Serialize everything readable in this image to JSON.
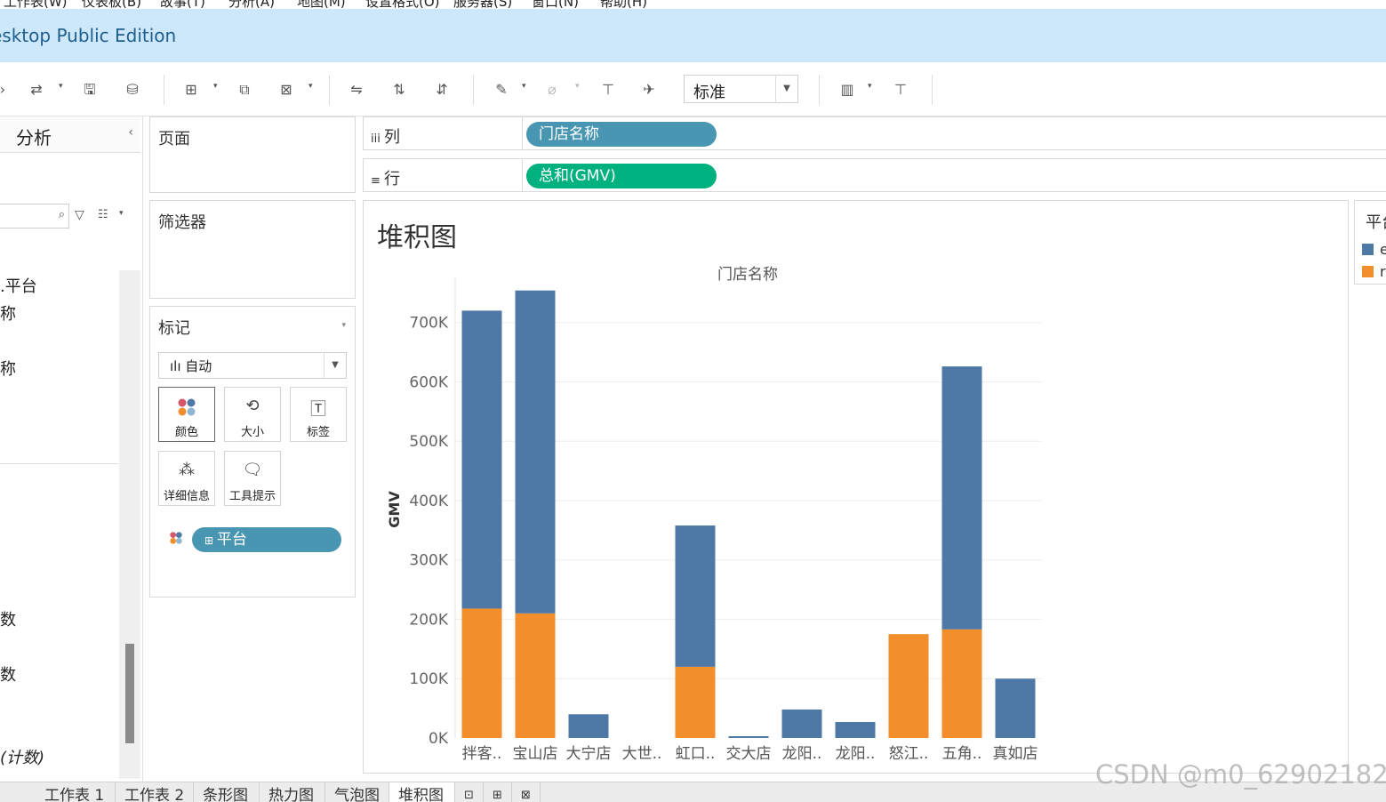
{
  "window": {
    "title": "esktop Public Edition",
    "menu": [
      "工作表(W)",
      "仪表板(B)",
      "故事(T)",
      "分析(A)",
      "地图(M)",
      "设置格式(O)",
      "服务器(S)",
      "窗口(N)",
      "帮助(H)"
    ]
  },
  "toolbar": {
    "fit_select": "标准"
  },
  "data_pane": {
    "tab_label": "分析",
    "collapse_icon": "chevron-left-icon",
    "fields": [
      ".平台",
      "称",
      "称",
      "数",
      "数",
      "(计数)"
    ]
  },
  "pages_shelf": {
    "title": "页面"
  },
  "filters_shelf": {
    "title": "筛选器"
  },
  "marks": {
    "title": "标记",
    "type": "自动",
    "buttons": {
      "color": "颜色",
      "size": "大小",
      "label": "标签",
      "detail": "详细信息",
      "tooltip": "工具提示"
    },
    "color_field": "平台",
    "colors": {
      "pill": "#4996b2"
    }
  },
  "columns_shelf": {
    "label": "列",
    "pill": "门店名称",
    "pill_color": "#4996b2"
  },
  "rows_shelf": {
    "label": "行",
    "pill": "总和(GMV)",
    "pill_color": "#00b180"
  },
  "view": {
    "sheet_title": "堆积图"
  },
  "legend": {
    "title": "平台",
    "items": [
      {
        "label": "e",
        "color": "#4e79a7"
      },
      {
        "label": "r",
        "color": "#f28e2b"
      }
    ]
  },
  "sheet_tabs": [
    "工作表 1",
    "工作表 2",
    "条形图",
    "热力图",
    "气泡图",
    "堆积图"
  ],
  "active_tab": "堆积图",
  "watermark": "CSDN @m0_62902182",
  "chart_data": {
    "type": "bar",
    "stacked": true,
    "title": "门店名称",
    "xlabel": "",
    "ylabel": "GMV",
    "categories": [
      "拌客..",
      "宝山店",
      "大宁店",
      "大世..",
      "虹口..",
      "交大店",
      "龙阳..",
      "龙阳..",
      "怒江..",
      "五角..",
      "真如店"
    ],
    "series": [
      {
        "name": "r",
        "color": "#f28e2b",
        "values": [
          218000,
          210000,
          0,
          0,
          120000,
          0,
          0,
          0,
          175000,
          183000,
          0
        ]
      },
      {
        "name": "e",
        "color": "#4e79a7",
        "values": [
          502000,
          544000,
          40000,
          0,
          238000,
          3000,
          48000,
          27000,
          0,
          443000,
          100000
        ]
      }
    ],
    "ylim": [
      0,
      770000
    ],
    "yticks": [
      0,
      100000,
      200000,
      300000,
      400000,
      500000,
      600000,
      700000
    ],
    "ytick_labels": [
      "0K",
      "100K",
      "200K",
      "300K",
      "400K",
      "500K",
      "600K",
      "700K"
    ],
    "grid": true,
    "legend": "right"
  }
}
